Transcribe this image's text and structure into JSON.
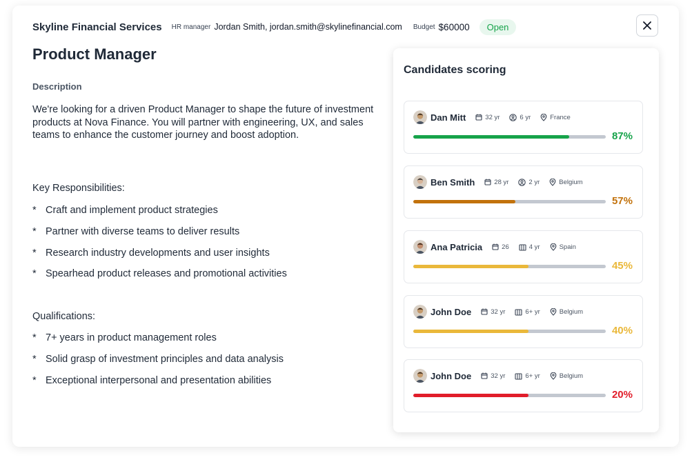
{
  "header": {
    "company": "Skyline Financial Services",
    "hr_label": "HR manager",
    "hr_value": "Jordan Smith, jordan.smith@skylinefinancial.com",
    "budget_label": "Budget",
    "budget_value": "$60000",
    "status": "Open"
  },
  "job": {
    "title": "Product Manager",
    "description_label": "Description",
    "description": "We're looking for a driven Product Manager to shape the future of investment products at Nova Finance. You will partner with engineering, UX, and sales teams to enhance the customer journey and boost adoption.",
    "responsibilities_heading": "Key Responsibilities:",
    "responsibilities": [
      "Craft and implement product strategies",
      "Partner with diverse teams to deliver results",
      "Research industry developments and user insights",
      "Spearhead product releases and promotional activities"
    ],
    "qualifications_heading": "Qualifications:",
    "qualifications": [
      "7+ years in product management roles",
      "Solid grasp of investment principles and data analysis",
      "Exceptional interpersonal and presentation abilities"
    ],
    "bullet_marker": "*"
  },
  "scoring": {
    "title": "Candidates scoring",
    "candidates": [
      {
        "name": "Dan Mitt",
        "age": "32 yr",
        "experience": "6 yr",
        "experience_icon": "user-circle-icon",
        "location": "France",
        "score": "87%",
        "score_value": 0.81,
        "color": "#16a34a"
      },
      {
        "name": "Ben Smith",
        "age": "28 yr",
        "experience": "2 yr",
        "experience_icon": "user-circle-icon",
        "location": "Belgium",
        "score": "57%",
        "score_value": 0.53,
        "color": "#c2720c"
      },
      {
        "name": "Ana Patricia",
        "age": "26",
        "experience": "4 yr",
        "experience_icon": "building-icon",
        "location": "Spain",
        "score": "45%",
        "score_value": 0.6,
        "color": "#eab83a"
      },
      {
        "name": "John Doe",
        "age": "32 yr",
        "experience": "6+ yr",
        "experience_icon": "building-icon",
        "location": "Belgium",
        "score": "40%",
        "score_value": 0.6,
        "color": "#eab83a"
      },
      {
        "name": "John Doe",
        "age": "32 yr",
        "experience": "6+ yr",
        "experience_icon": "building-icon",
        "location": "Belgium",
        "score": "20%",
        "score_value": 0.6,
        "color": "#e11d2a"
      }
    ]
  }
}
